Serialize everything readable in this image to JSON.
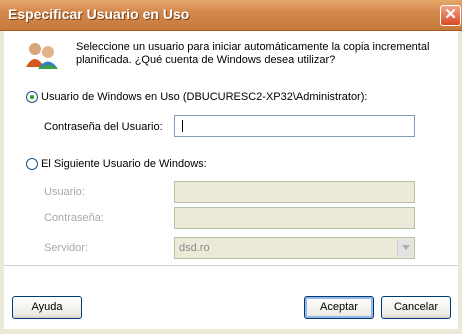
{
  "window": {
    "title": "Especificar Usuario en Uso",
    "close_glyph": "✕"
  },
  "intro": {
    "icon": "users-icon",
    "text": "Seleccione un usuario para iniciar automáticamente la copia incremental planificada. ¿Qué cuenta de Windows desea utilizar?"
  },
  "option_current": {
    "label": "Usuario de Windows en Uso (DBUCURESC2-XP32\\Administrator):",
    "selected": true,
    "password_label": "Contraseña del Usuario:",
    "password_value": ""
  },
  "option_other": {
    "label": "El Siguiente Usuario de Windows:",
    "selected": false,
    "user_label": "Usuario:",
    "user_value": "",
    "password_label": "Contraseña:",
    "password_value": "",
    "server_label": "Servidor:",
    "server_value": "dsd.ro"
  },
  "buttons": {
    "help": "Ayuda",
    "ok": "Aceptar",
    "cancel": "Cancelar"
  }
}
